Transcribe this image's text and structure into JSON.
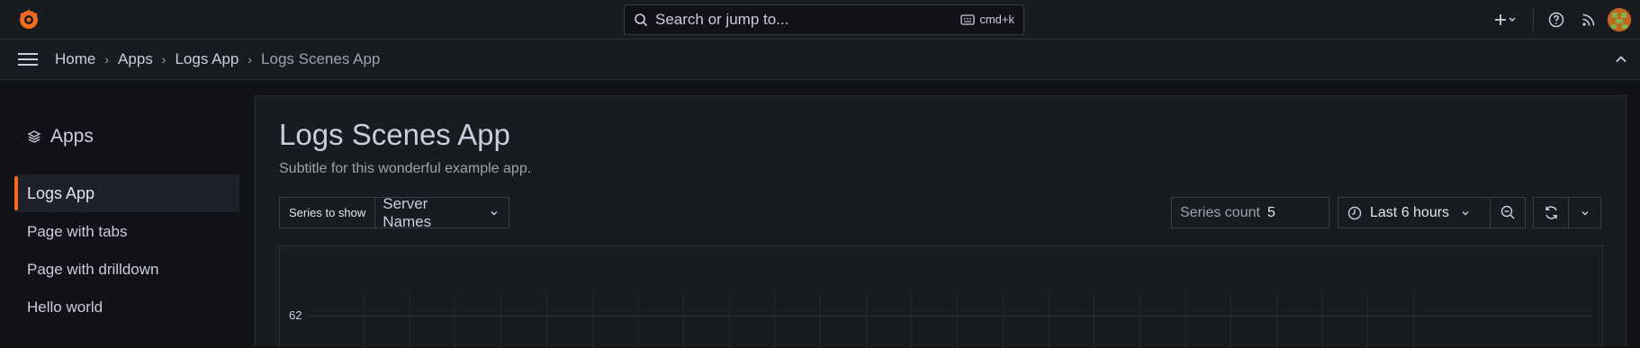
{
  "topbar": {
    "logo_icon": "grafana-logo-icon",
    "search_placeholder": "Search or jump to...",
    "search_shortcut": "cmd+k",
    "icons": [
      "plus-icon",
      "help-icon",
      "rss-icon",
      "avatar"
    ]
  },
  "breadcrumb": {
    "items": [
      "Home",
      "Apps",
      "Logs App",
      "Logs Scenes App"
    ]
  },
  "sidebar": {
    "title": "Apps",
    "items": [
      {
        "label": "Logs App",
        "active": true
      },
      {
        "label": "Page with tabs",
        "active": false
      },
      {
        "label": "Page with drilldown",
        "active": false
      },
      {
        "label": "Hello world",
        "active": false
      }
    ]
  },
  "main": {
    "title": "Logs Scenes App",
    "subtitle": "Subtitle for this wonderful example app.",
    "variable_label": "Series to show",
    "variable_value": "Server Names",
    "series_count_label": "Series count",
    "series_count_value": "5",
    "time_range": "Last 6 hours"
  },
  "chart_data": {
    "type": "line",
    "y_ticks": [
      "62"
    ]
  },
  "colors": {
    "accent": "#f46b20",
    "background": "#111217",
    "panel": "#181b1f"
  }
}
